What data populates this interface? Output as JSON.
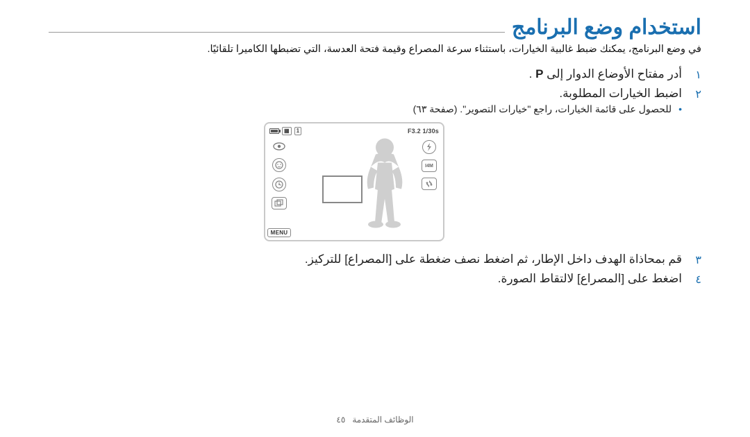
{
  "title": "استخدام وضع البرنامج",
  "intro": "في وضع البرنامج، يمكنك ضبط غالبية الخيارات، باستثناء سرعة المصراع وقيمة فتحة العدسة، التي تضبطها الكاميرا تلقائيًا.",
  "steps": {
    "n1": "١",
    "s1_pre": "أدر مفتاح الأوضاع الدوار إلى ",
    "s1_mode": "P",
    "s1_post": " .",
    "n2": "٢",
    "s2": "اضبط الخيارات المطلوبة.",
    "s2_sub": "للحصول على قائمة الخيارات، راجع \"خيارات التصوير\". (صفحة ٦٣)",
    "n3": "٣",
    "s3": "قم بمحاذاة الهدف داخل الإطار، ثم اضغط نصف ضغطة على [المصراع] للتركيز.",
    "n4": "٤",
    "s4": "اضغط على [المصراع] لالتقاط الصورة."
  },
  "camera": {
    "fval": "F3.2 1/30s",
    "count": "1",
    "menu": "MENU"
  },
  "icons": {
    "eye": "eye-icon",
    "face": "face-icon",
    "timer": "timer-icon",
    "drive": "drive-icon",
    "flash": "flash-icon",
    "size": "size-icon",
    "stab": "stabilizer-icon",
    "sd": "sd-icon",
    "batt": "battery-icon"
  },
  "footer": {
    "label": "الوظائف المتقدمة",
    "page": "٤٥"
  }
}
